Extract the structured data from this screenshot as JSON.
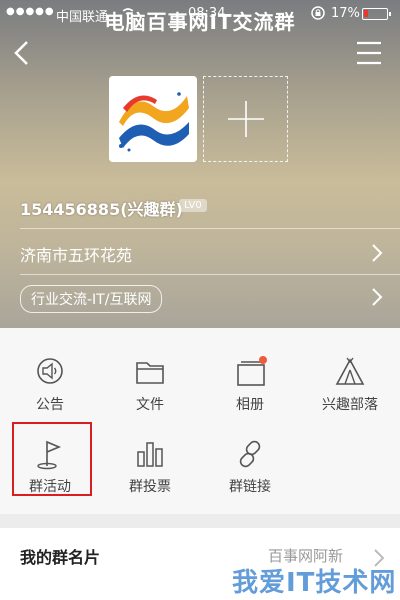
{
  "status_bar": {
    "carrier": "中国联通",
    "time": "08:34",
    "battery_percent": "17%",
    "battery_level": 0.17,
    "battery_color": "#e8392c"
  },
  "header": {
    "title": "电脑百事网IT交流群",
    "back_icon": "chevron-left-icon",
    "menu_icon": "menu-icon"
  },
  "group": {
    "id_text": "154456885(兴趣群)",
    "level": "LV0",
    "address": "济南市五环花苑",
    "category": "行业交流-IT/互联网"
  },
  "features": [
    {
      "label": "公告",
      "icon": "announcement-icon"
    },
    {
      "label": "文件",
      "icon": "folder-icon"
    },
    {
      "label": "相册",
      "icon": "album-icon"
    },
    {
      "label": "兴趣部落",
      "icon": "tent-icon"
    },
    {
      "label": "群活动",
      "icon": "flag-icon"
    },
    {
      "label": "群投票",
      "icon": "bar-chart-icon"
    },
    {
      "label": "群链接",
      "icon": "link-icon"
    }
  ],
  "card": {
    "title": "我的群名片",
    "value": "百事网阿新"
  },
  "watermark": "我爱IT技术网",
  "colors": {
    "accent_red": "#d81e1e",
    "album_dot": "#f05a3c"
  }
}
